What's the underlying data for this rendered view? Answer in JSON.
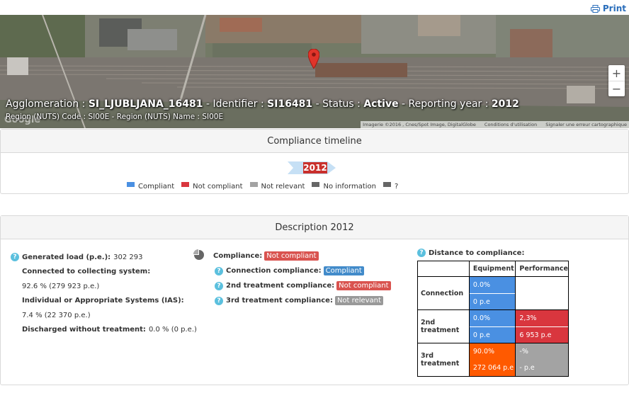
{
  "print": {
    "label": "Print",
    "icon": "printer-icon"
  },
  "map": {
    "title": {
      "agg_label": "Agglomeration : ",
      "agg_value": "SI_LJUBLJANA_16481",
      "id_label": " - Identifier : ",
      "id_value": "SI16481",
      "status_label": " - Status : ",
      "status_value": "Active",
      "year_label": " - Reporting year : ",
      "year_value": "2012"
    },
    "subtitle": "Region (NUTS) Code : SI00E - Region (NUTS) Name : SI00E",
    "google_logo": "Google",
    "attribution": [
      "Imagerie ©2016 , Cnes/Spot Image, DigitalGlobe",
      "Conditions d'utilisation",
      "Signaler une erreur cartographique"
    ],
    "zoom_in": "+",
    "zoom_out": "−"
  },
  "timeline": {
    "title": "Compliance timeline",
    "year": "2012",
    "legend": [
      {
        "label": "Compliant",
        "color": "#4a90e2"
      },
      {
        "label": "Not compliant",
        "color": "#d9363e"
      },
      {
        "label": "Not relevant",
        "color": "#a3a3a3"
      },
      {
        "label": "No information",
        "color": "#666666"
      },
      {
        "label": "?",
        "color": "#666666"
      }
    ]
  },
  "description": {
    "title": "Description 2012",
    "generated_load_label": "Generated load (p.e.):",
    "generated_load_value": "302 293",
    "connected_label": "Connected to collecting system:",
    "connected_value": "92.6 % (279 923 p.e.)",
    "ias_label": "Individual or Appropriate Systems (IAS):",
    "ias_value": "7.4 % (22 370 p.e.)",
    "discharged_label": "Discharged without treatment:",
    "discharged_value": "0.0 % (0 p.e.)",
    "compliance_label": "Compliance:",
    "compliance_value": "Not compliant",
    "connection_compliance_label": "Connection compliance:",
    "connection_compliance_value": "Compliant",
    "second_compliance_label": "2nd treatment compliance:",
    "second_compliance_value": "Not compliant",
    "third_compliance_label": "3rd treatment compliance:",
    "third_compliance_value": "Not relevant",
    "distance_label": "Distance to compliance:",
    "table": {
      "col_equipment": "Equipment",
      "col_performance": "Performance",
      "rows": [
        {
          "label": "Connection",
          "eq_pct": "0.0%",
          "eq_pe": "0 p.e",
          "perf_pct": "",
          "perf_pe": ""
        },
        {
          "label": "2nd treatment",
          "eq_pct": "0.0%",
          "eq_pe": "0 p.e",
          "perf_pct": "2,3%",
          "perf_pe": "6 953 p.e"
        },
        {
          "label": "3rd treatment",
          "eq_pct": "90.0%",
          "eq_pe": "272 064 p.e",
          "perf_pct": "-%",
          "perf_pe": "- p.e"
        }
      ]
    }
  }
}
